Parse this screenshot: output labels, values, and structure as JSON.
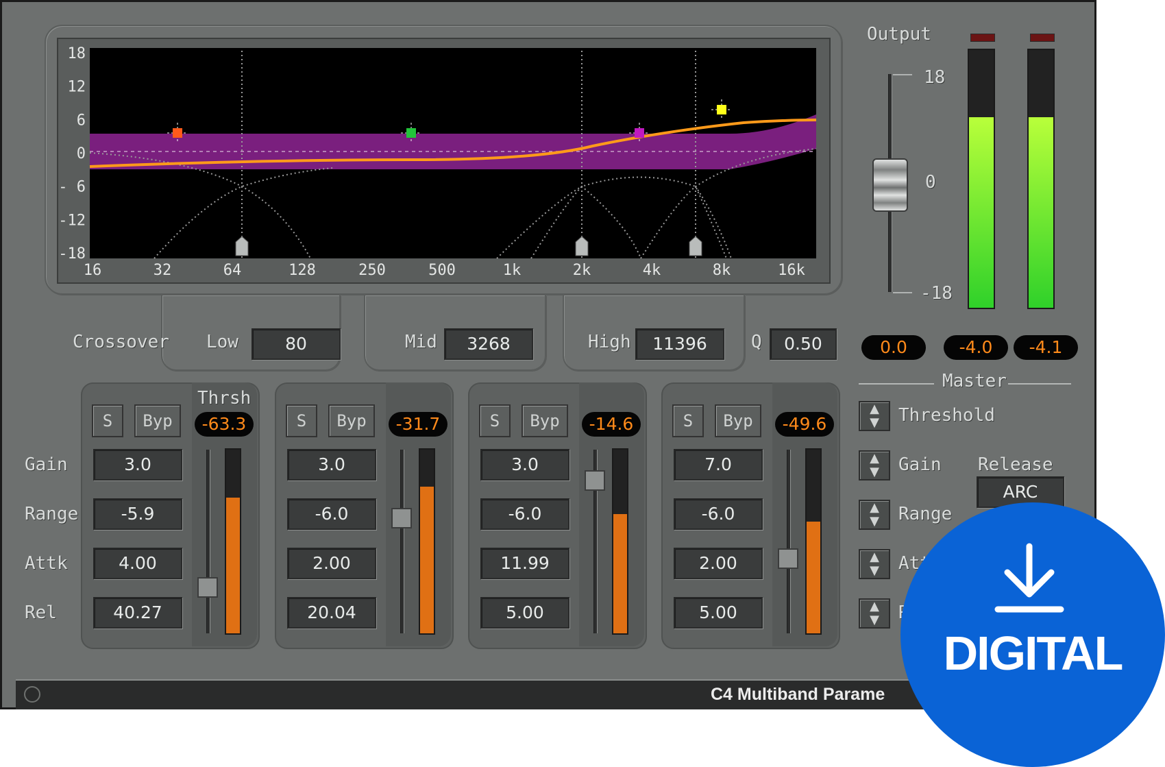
{
  "eq_display": {
    "y_ticks": [
      "18",
      "12",
      "6",
      "0",
      "- 6",
      "-12",
      "-18"
    ],
    "x_ticks": [
      "16",
      "32",
      "64",
      "128",
      "250",
      "500",
      "1k",
      "2k",
      "4k",
      "8k",
      "16k"
    ],
    "colors": {
      "band_fill": "#7a1f7e",
      "curve": "#ff9a1a",
      "low_dot": "#ff5a1a",
      "mid_dot": "#22c43a",
      "midhigh_dot": "#c019c0",
      "high_dot": "#ffff1a"
    }
  },
  "crossover": {
    "label": "Crossover",
    "low_label": "Low",
    "low_value": "80",
    "mid_label": "Mid",
    "mid_value": "3268",
    "high_label": "High",
    "high_value": "11396",
    "q_label": "Q",
    "q_value": "0.50"
  },
  "row_labels": {
    "gain": "Gain",
    "range": "Range",
    "attk": "Attk",
    "rel": "Rel"
  },
  "thrsh_label": "Thrsh",
  "bands": [
    {
      "solo": "S",
      "bypass": "Byp",
      "thrsh": "-63.3",
      "gain": "3.0",
      "range": "-5.9",
      "attk": "4.00",
      "rel": "40.27",
      "thrsh_level": 0.24,
      "meter_level": 0.74
    },
    {
      "solo": "S",
      "bypass": "Byp",
      "thrsh": "-31.7",
      "gain": "3.0",
      "range": "-6.0",
      "attk": "2.00",
      "rel": "20.04",
      "thrsh_level": 0.63,
      "meter_level": 0.8
    },
    {
      "solo": "S",
      "bypass": "Byp",
      "thrsh": "-14.6",
      "gain": "3.0",
      "range": "-6.0",
      "attk": "11.99",
      "rel": "5.00",
      "thrsh_level": 0.83,
      "meter_level": 0.65
    },
    {
      "solo": "S",
      "bypass": "Byp",
      "thrsh": "-49.6",
      "gain": "7.0",
      "range": "-6.0",
      "attk": "2.00",
      "rel": "5.00",
      "thrsh_level": 0.38,
      "meter_level": 0.61
    }
  ],
  "output": {
    "label": "Output",
    "scale": [
      "18",
      "0",
      "-18"
    ],
    "gain_value": "0.0",
    "meter_left": "-4.0",
    "meter_right": "-4.1",
    "meter_left_level": 0.74,
    "meter_right_level": 0.74
  },
  "master": {
    "label": "Master",
    "threshold": "Threshold",
    "gain": "Gain",
    "range": "Range",
    "attk": "Att",
    "rel": "R",
    "release_label": "Release",
    "release_value": "ARC"
  },
  "footer": {
    "title": "C4 Multiband Parame"
  },
  "badge": {
    "label": "DIGITAL",
    "color": "#0a63d6",
    "icon": "download-arrow-icon"
  }
}
